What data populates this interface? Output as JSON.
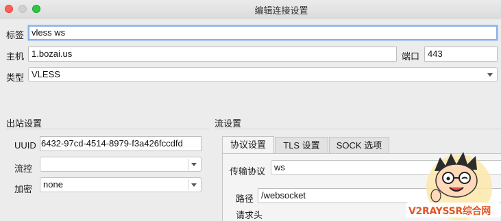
{
  "window": {
    "title": "编辑连接设置"
  },
  "form": {
    "tag_label": "标签",
    "tag_value": "vless ws",
    "host_label": "主机",
    "host_value": "1.bozai.us",
    "port_label": "端口",
    "port_value": "443",
    "type_label": "类型",
    "type_value": "VLESS"
  },
  "outbound": {
    "title": "出站设置",
    "uuid_label": "UUID",
    "uuid_value": "6432-97cd-4514-8979-f3a426fccdfd",
    "flow_label": "流控",
    "flow_value": "",
    "encryption_label": "加密",
    "encryption_value": "none"
  },
  "stream": {
    "title": "流设置",
    "tabs": [
      "协议设置",
      "TLS 设置",
      "SOCK 选项"
    ],
    "transport_label": "传输协议",
    "transport_value": "ws",
    "path_label": "路径",
    "path_value": "/websocket",
    "headers_label": "请求头"
  },
  "watermark": {
    "text": "V2RAYSSR综合网"
  },
  "colors": {
    "accent_focus": "#8ab3e6",
    "close": "#fe5f57",
    "zoom": "#2ac940"
  }
}
